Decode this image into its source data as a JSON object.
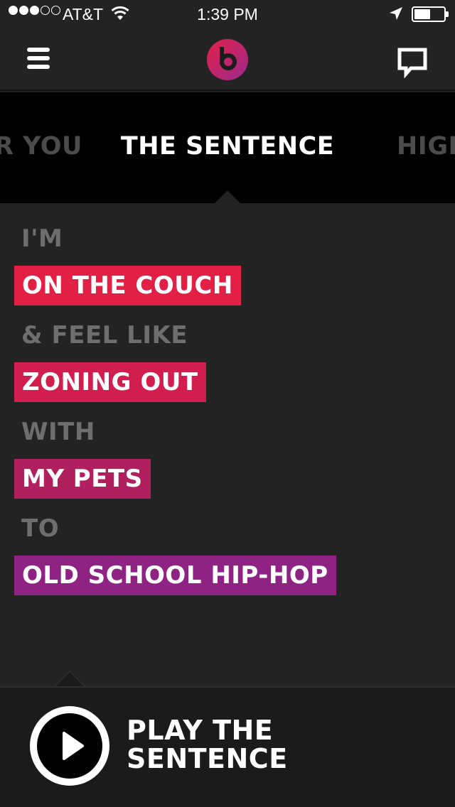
{
  "status_bar": {
    "carrier": "AT&T",
    "time": "1:39 PM",
    "signal_bars_filled": 3,
    "signal_bars_total": 5,
    "battery_level": 0.55
  },
  "nav": {
    "menu_icon": "hamburger-menu-icon",
    "logo_icon": "beats-logo-icon",
    "chat_icon": "chat-bubble-icon",
    "logo_colors": [
      "#e4204a",
      "#9b2a8c"
    ]
  },
  "tabs": [
    {
      "label": "R YOU",
      "active": false
    },
    {
      "label": "THE SENTENCE",
      "active": true
    },
    {
      "label": "HIGH",
      "active": false
    }
  ],
  "sentence": {
    "static_1": "I'M",
    "choice_1": {
      "label": "ON THE COUCH",
      "color": "#e21f44"
    },
    "static_2": "& FEEL LIKE",
    "choice_2": {
      "label": "ZONING OUT",
      "color": "#d21e4f"
    },
    "static_3": "WITH",
    "choice_3": {
      "label": "MY PETS",
      "color": "#b0205f"
    },
    "static_4": "TO",
    "choice_4": {
      "label": "OLD SCHOOL HIP-HOP",
      "color": "#8e2384"
    }
  },
  "bottom": {
    "play_line_1": "PLAY THE",
    "play_line_2": "SENTENCE",
    "play_icon": "play-circle-icon"
  }
}
